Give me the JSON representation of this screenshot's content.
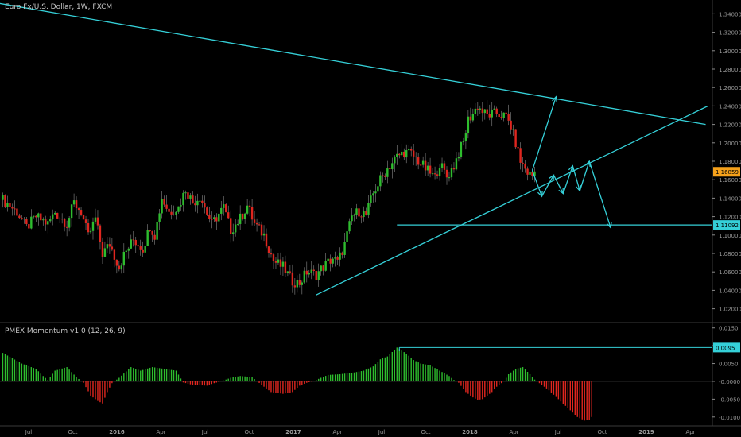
{
  "header": {
    "title": "Euro Fx/U.S. Dollar, 1W, FXCM",
    "indicator": "PMEX Momentum v1.0 (12, 26, 9)"
  },
  "colors": {
    "up": "#2ebd2e",
    "down": "#e0261f",
    "cyan": "#35d0d8",
    "axis": "#8a8a8a",
    "last": "#f5a11b"
  },
  "chart_data": [
    {
      "type": "candlestick",
      "title": "Euro Fx/U.S. Dollar, 1W, FXCM",
      "ylim": [
        1.005,
        1.355
      ],
      "y_ticks": [
        "1.34000",
        "1.32000",
        "1.30000",
        "1.28000",
        "1.26000",
        "1.24000",
        "1.22000",
        "1.20000",
        "1.18000",
        "1.16000",
        "1.14000",
        "1.12000",
        "1.10000",
        "1.08000",
        "1.06000",
        "1.04000",
        "1.02000"
      ],
      "x_ticks": [
        "Jul",
        "Oct",
        "2016",
        "Apr",
        "Jul",
        "Oct",
        "2017",
        "Apr",
        "Jul",
        "Oct",
        "2018",
        "Apr",
        "Jul",
        "Oct",
        "2019",
        "Apr"
      ],
      "price_labels": [
        {
          "text": "1.16859",
          "value": 1.16859,
          "color": "#f5a11b"
        },
        {
          "text": "1.11092",
          "value": 1.11092,
          "color": "#35d0d8"
        }
      ],
      "close_path": [
        [
          0,
          1.138
        ],
        [
          6,
          1.125
        ],
        [
          10,
          1.108
        ],
        [
          14,
          1.12
        ],
        [
          19,
          1.112
        ],
        [
          22,
          1.125
        ],
        [
          27,
          1.112
        ],
        [
          30,
          1.135
        ],
        [
          33,
          1.125
        ],
        [
          36,
          1.098
        ],
        [
          39,
          1.118
        ],
        [
          42,
          1.08
        ],
        [
          45,
          1.09
        ],
        [
          49,
          1.065
        ],
        [
          51,
          1.078
        ],
        [
          55,
          1.095
        ],
        [
          59,
          1.085
        ],
        [
          62,
          1.11
        ],
        [
          64,
          1.1
        ],
        [
          67,
          1.14
        ],
        [
          70,
          1.125
        ],
        [
          74,
          1.13
        ],
        [
          77,
          1.15
        ],
        [
          80,
          1.135
        ],
        [
          83,
          1.142
        ],
        [
          88,
          1.112
        ],
        [
          93,
          1.13
        ],
        [
          96,
          1.105
        ],
        [
          100,
          1.118
        ],
        [
          103,
          1.132
        ],
        [
          106,
          1.112
        ],
        [
          110,
          1.1
        ],
        [
          114,
          1.072
        ],
        [
          118,
          1.065
        ],
        [
          122,
          1.05
        ],
        [
          125,
          1.048
        ],
        [
          128,
          1.06
        ],
        [
          132,
          1.057
        ],
        [
          134,
          1.063
        ],
        [
          136,
          1.068
        ],
        [
          139,
          1.075
        ],
        [
          141,
          1.07
        ],
        [
          144,
          1.09
        ],
        [
          147,
          1.12
        ],
        [
          150,
          1.126
        ],
        [
          153,
          1.122
        ],
        [
          156,
          1.145
        ],
        [
          159,
          1.16
        ],
        [
          162,
          1.172
        ],
        [
          166,
          1.185
        ],
        [
          169,
          1.19
        ],
        [
          172,
          1.188
        ],
        [
          175,
          1.18
        ],
        [
          178,
          1.172
        ],
        [
          182,
          1.162
        ],
        [
          184,
          1.178
        ],
        [
          187,
          1.163
        ],
        [
          190,
          1.175
        ],
        [
          192,
          1.19
        ],
        [
          194,
          1.2
        ],
        [
          196,
          1.225
        ],
        [
          198,
          1.232
        ],
        [
          200,
          1.24
        ],
        [
          202,
          1.234
        ],
        [
          204,
          1.23
        ],
        [
          208,
          1.232
        ],
        [
          212,
          1.228
        ],
        [
          214,
          1.218
        ],
        [
          216,
          1.2
        ],
        [
          218,
          1.18
        ],
        [
          221,
          1.168
        ],
        [
          223,
          1.164
        ],
        [
          224,
          1.169
        ]
      ],
      "trendlines": [
        {
          "from": [
            -3,
            1.352
          ],
          "to": [
            296,
            1.22
          ]
        },
        {
          "from": [
            132,
            1.035
          ],
          "to": [
            297,
            1.24
          ]
        },
        {
          "from": [
            166,
            1.11092
          ],
          "to": [
            300,
            1.11092
          ]
        }
      ],
      "arrows": [
        {
          "from": [
            223,
            1.17
          ],
          "to": [
            233,
            1.25
          ]
        },
        {
          "from": [
            223,
            1.17
          ],
          "to": [
            227,
            1.142
          ]
        },
        {
          "from": [
            227,
            1.142
          ],
          "to": [
            232,
            1.165
          ]
        },
        {
          "from": [
            232,
            1.165
          ],
          "to": [
            236,
            1.145
          ]
        },
        {
          "from": [
            236,
            1.145
          ],
          "to": [
            240,
            1.175
          ]
        },
        {
          "from": [
            240,
            1.175
          ],
          "to": [
            243,
            1.148
          ]
        },
        {
          "from": [
            243,
            1.148
          ],
          "to": [
            247,
            1.18
          ]
        },
        {
          "from": [
            247,
            1.18
          ],
          "to": [
            256,
            1.108
          ]
        }
      ]
    },
    {
      "type": "histogram",
      "title": "PMEX Momentum v1.0 (12, 26, 9)",
      "ylim": [
        -0.0125,
        0.0165
      ],
      "y_ticks": [
        "0.0150",
        "0.0100",
        "0.0050",
        "-0.0000",
        "-0.0050",
        "-0.0100"
      ],
      "price_labels": [
        {
          "text": "0.0095",
          "value": 0.0095,
          "color": "#35d0d8"
        }
      ],
      "level_line": {
        "from": 167,
        "to": 300,
        "value": 0.0095
      },
      "path": [
        [
          0,
          0.008
        ],
        [
          8,
          0.005
        ],
        [
          14,
          0.0035
        ],
        [
          17,
          0.0015
        ],
        [
          19,
          0.0004
        ],
        [
          22,
          0.003
        ],
        [
          27,
          0.004
        ],
        [
          31,
          0.0012
        ],
        [
          34,
          -0.0004
        ],
        [
          37,
          -0.004
        ],
        [
          40,
          -0.0055
        ],
        [
          42,
          -0.0062
        ],
        [
          44,
          -0.003
        ],
        [
          46,
          -0.0005
        ],
        [
          49,
          0.001
        ],
        [
          54,
          0.004
        ],
        [
          58,
          0.003
        ],
        [
          63,
          0.004
        ],
        [
          68,
          0.0035
        ],
        [
          73,
          0.003
        ],
        [
          76,
          -0.0003
        ],
        [
          80,
          -0.001
        ],
        [
          86,
          -0.0012
        ],
        [
          89,
          -0.0005
        ],
        [
          92,
          0.0
        ],
        [
          96,
          0.001
        ],
        [
          100,
          0.0015
        ],
        [
          105,
          0.0012
        ],
        [
          109,
          -0.001
        ],
        [
          113,
          -0.003
        ],
        [
          118,
          -0.0035
        ],
        [
          122,
          -0.003
        ],
        [
          125,
          -0.0012
        ],
        [
          128,
          -0.0004
        ],
        [
          131,
          0.0001
        ],
        [
          134,
          0.001
        ],
        [
          137,
          0.0018
        ],
        [
          142,
          0.002
        ],
        [
          148,
          0.0025
        ],
        [
          152,
          0.003
        ],
        [
          156,
          0.0042
        ],
        [
          159,
          0.0062
        ],
        [
          162,
          0.007
        ],
        [
          166,
          0.0095
        ],
        [
          170,
          0.0078
        ],
        [
          173,
          0.006
        ],
        [
          176,
          0.005
        ],
        [
          180,
          0.0045
        ],
        [
          184,
          0.003
        ],
        [
          188,
          0.0015
        ],
        [
          190,
          0.0004
        ],
        [
          192,
          -0.0004
        ],
        [
          195,
          -0.003
        ],
        [
          198,
          -0.0045
        ],
        [
          200,
          -0.0052
        ],
        [
          202,
          -0.005
        ],
        [
          204,
          -0.004
        ],
        [
          206,
          -0.003
        ],
        [
          208,
          -0.0015
        ],
        [
          211,
          0.0
        ],
        [
          213,
          0.002
        ],
        [
          216,
          0.0035
        ],
        [
          219,
          0.004
        ],
        [
          222,
          0.002
        ],
        [
          224,
          0.0005
        ],
        [
          226,
          -0.0005
        ],
        [
          230,
          -0.0025
        ],
        [
          234,
          -0.005
        ],
        [
          238,
          -0.0075
        ],
        [
          242,
          -0.01
        ],
        [
          245,
          -0.011
        ],
        [
          247,
          -0.0108
        ],
        [
          248,
          -0.01
        ]
      ]
    }
  ]
}
